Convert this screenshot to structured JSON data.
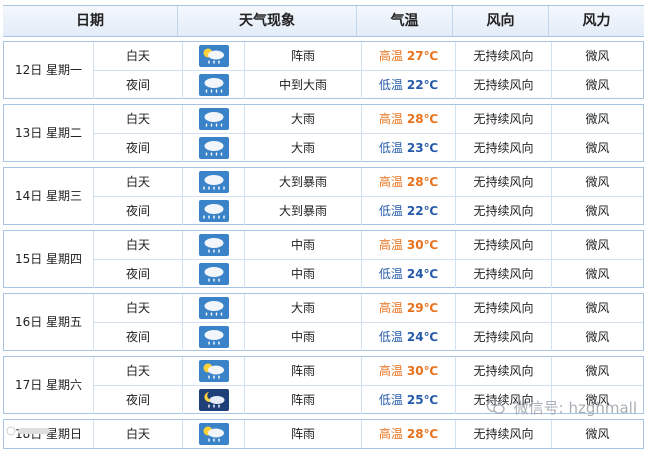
{
  "headers": {
    "date": "日期",
    "weather": "天气现象",
    "temperature": "气温",
    "wind_direction": "风向",
    "wind_force": "风力"
  },
  "days": [
    {
      "date": "12日 星期一",
      "rows": [
        {
          "period": "白天",
          "icon": "sun-shower-icon",
          "condition": "阵雨",
          "temp_label": "高温",
          "temp": "27℃",
          "wind_direction": "无持续风向",
          "wind_force": "微风"
        },
        {
          "period": "夜间",
          "icon": "heavy-rain-icon",
          "condition": "中到大雨",
          "temp_label": "低温",
          "temp": "22℃",
          "wind_direction": "无持续风向",
          "wind_force": "微风"
        }
      ]
    },
    {
      "date": "13日 星期二",
      "rows": [
        {
          "period": "白天",
          "icon": "heavy-rain-icon",
          "condition": "大雨",
          "temp_label": "高温",
          "temp": "28℃",
          "wind_direction": "无持续风向",
          "wind_force": "微风"
        },
        {
          "period": "夜间",
          "icon": "heavy-rain-icon",
          "condition": "大雨",
          "temp_label": "低温",
          "temp": "23℃",
          "wind_direction": "无持续风向",
          "wind_force": "微风"
        }
      ]
    },
    {
      "date": "14日 星期三",
      "rows": [
        {
          "period": "白天",
          "icon": "rainstorm-icon",
          "condition": "大到暴雨",
          "temp_label": "高温",
          "temp": "28℃",
          "wind_direction": "无持续风向",
          "wind_force": "微风"
        },
        {
          "period": "夜间",
          "icon": "rainstorm-icon",
          "condition": "大到暴雨",
          "temp_label": "低温",
          "temp": "22℃",
          "wind_direction": "无持续风向",
          "wind_force": "微风"
        }
      ]
    },
    {
      "date": "15日 星期四",
      "rows": [
        {
          "period": "白天",
          "icon": "moderate-rain-icon",
          "condition": "中雨",
          "temp_label": "高温",
          "temp": "30℃",
          "wind_direction": "无持续风向",
          "wind_force": "微风"
        },
        {
          "period": "夜间",
          "icon": "moderate-rain-icon",
          "condition": "中雨",
          "temp_label": "低温",
          "temp": "24℃",
          "wind_direction": "无持续风向",
          "wind_force": "微风"
        }
      ]
    },
    {
      "date": "16日 星期五",
      "rows": [
        {
          "period": "白天",
          "icon": "heavy-rain-icon",
          "condition": "大雨",
          "temp_label": "高温",
          "temp": "29℃",
          "wind_direction": "无持续风向",
          "wind_force": "微风"
        },
        {
          "period": "夜间",
          "icon": "moderate-rain-icon",
          "condition": "中雨",
          "temp_label": "低温",
          "temp": "24℃",
          "wind_direction": "无持续风向",
          "wind_force": "微风"
        }
      ]
    },
    {
      "date": "17日 星期六",
      "rows": [
        {
          "period": "白天",
          "icon": "sun-shower-icon",
          "condition": "阵雨",
          "temp_label": "高温",
          "temp": "30℃",
          "wind_direction": "无持续风向",
          "wind_force": "微风"
        },
        {
          "period": "夜间",
          "icon": "night-shower-icon",
          "condition": "阵雨",
          "temp_label": "低温",
          "temp": "25℃",
          "wind_direction": "无持续风向",
          "wind_force": "微风"
        }
      ]
    },
    {
      "date": "18日 星期日",
      "rows": [
        {
          "period": "白天",
          "icon": "sun-shower-icon",
          "condition": "阵雨",
          "temp_label": "高温",
          "temp": "28℃",
          "wind_direction": "无持续风向",
          "wind_force": "微风"
        }
      ]
    }
  ],
  "watermark": "微信号: hzghmall",
  "colors": {
    "header_bg": "#e3ecf8",
    "border": "#a9c4e3",
    "high_temp": "#e8711c",
    "low_temp": "#245aa8",
    "icon_day_bg": "#3b83c9",
    "icon_night_bg": "#1f3f78"
  }
}
